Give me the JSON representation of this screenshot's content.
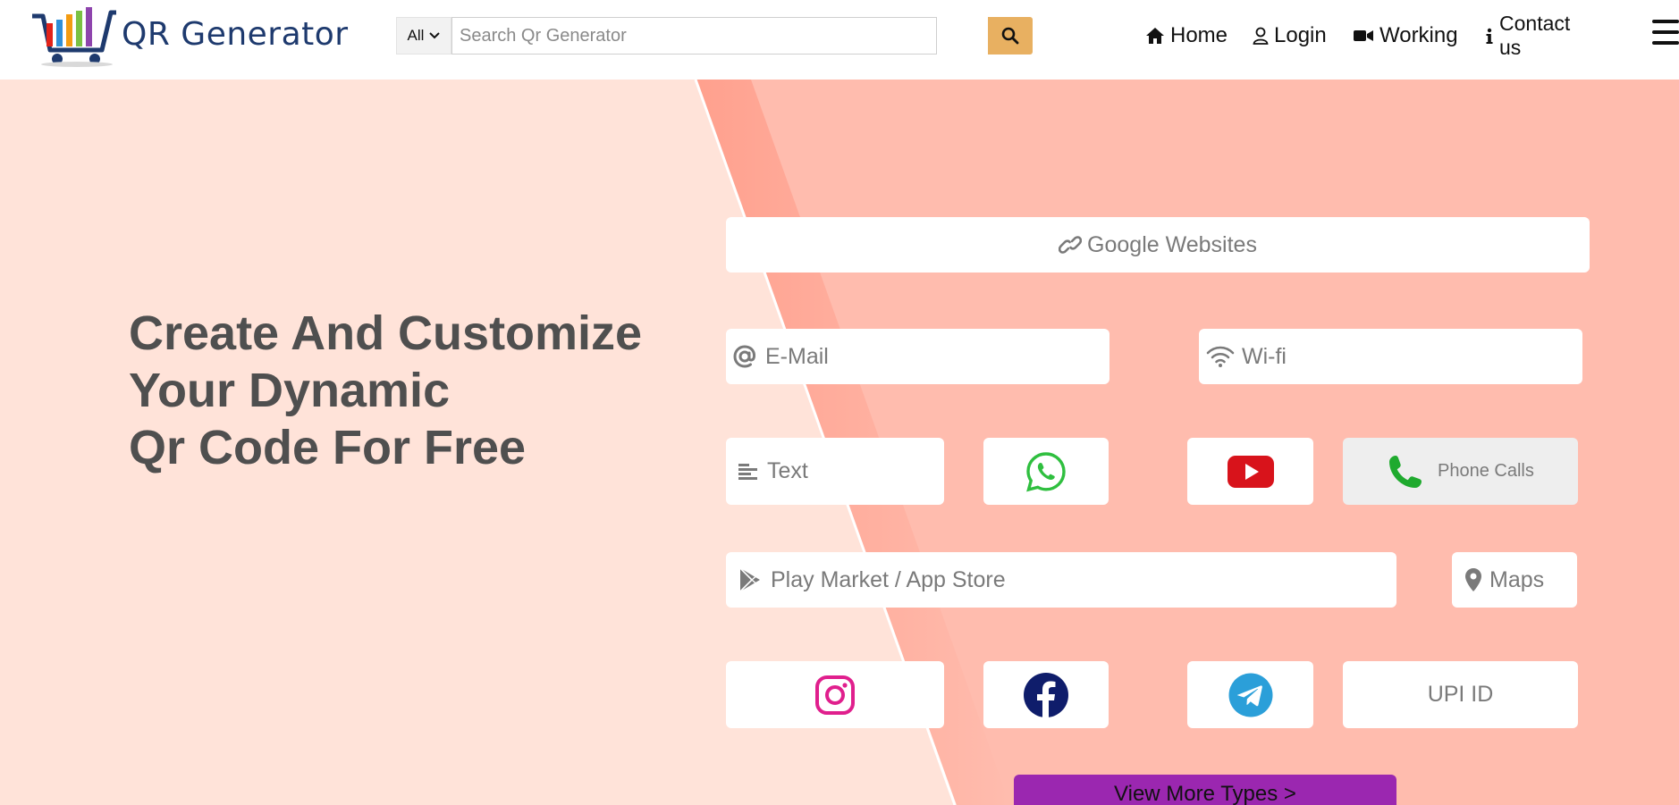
{
  "header": {
    "brand": "QR Generator",
    "search": {
      "category": "All",
      "placeholder": "Search Qr Generator"
    },
    "nav": {
      "home": "Home",
      "login": "Login",
      "working": "Working",
      "contact": "Contact us"
    }
  },
  "hero": {
    "headline": [
      "Create And Customize",
      "Your Dynamic",
      "Qr Code For Free"
    ]
  },
  "types": {
    "google": "Google Websites",
    "email": "E-Mail",
    "wifi": "Wi-fi",
    "text": "Text",
    "phone": "Phone Calls",
    "play": "Play Market / App Store",
    "maps": "Maps",
    "upi": "UPI ID",
    "icons": [
      "link-icon",
      "at-icon",
      "wifi-icon",
      "align-left-icon",
      "whatsapp-icon",
      "youtube-icon",
      "phone-icon",
      "google-play-icon",
      "map-pin-icon",
      "instagram-icon",
      "facebook-icon",
      "telegram-icon"
    ]
  },
  "more_button": "View More Types >",
  "colors": {
    "brand_navy": "#1e3a6e",
    "search_button": "#e8b061",
    "hero_light": "#ffe3d9",
    "hero_salmon": "#ffbcae",
    "whatsapp": "#2fbf3f",
    "youtube": "#d8131b",
    "phone": "#1faa2e",
    "instagram": "#e01f8d",
    "facebook": "#0f1d6b",
    "telegram": "#2b9fd9",
    "cta": "#9b27b0"
  }
}
